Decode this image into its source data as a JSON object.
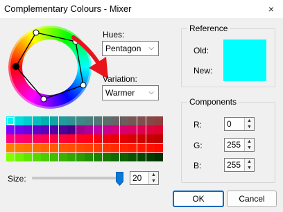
{
  "window": {
    "title": "Complementary Colours - Mixer",
    "close_icon": "×"
  },
  "hues": {
    "label": "Hues:",
    "value": "Pentagon"
  },
  "variation": {
    "label": "Variation:",
    "value": "Warmer"
  },
  "reference": {
    "title": "Reference",
    "old_label": "Old:",
    "new_label": "New:",
    "color": "#00ffff"
  },
  "components": {
    "title": "Components",
    "r_label": "R:",
    "r_value": "0",
    "g_label": "G:",
    "g_value": "255",
    "b_label": "B:",
    "b_value": "255"
  },
  "size": {
    "label": "Size:",
    "value": "20",
    "level": 20,
    "max": 20
  },
  "buttons": {
    "ok": "OK",
    "cancel": "Cancel"
  },
  "colors": {
    "accent": "#0067c0",
    "arrow": "#e8141c",
    "slider_thumb": "#0a78d7"
  },
  "palette": [
    [
      "#00f6f6",
      "#00dede",
      "#00cece",
      "#00bebe",
      "#00afaf",
      "#11a5a5",
      "#219b9b",
      "#2f9191",
      "#3d8787",
      "#4a7e7e",
      "#547575",
      "#5d6d6d",
      "#656565",
      "#6d5d5d",
      "#765555",
      "#7f4e4e",
      "#884747",
      "#8f3f3f"
    ],
    [
      "#7f00ff",
      "#7600ee",
      "#6d00dd",
      "#6400cc",
      "#5c00bb",
      "#5500ab",
      "#4d009a",
      "#460088",
      "#a0008c",
      "#b0009a",
      "#c000a8",
      "#cc0090",
      "#d40080",
      "#d80070",
      "#dc0062",
      "#de0050",
      "#e00040",
      "#e20030"
    ],
    [
      "#ff007f",
      "#ff0074",
      "#ff0068",
      "#ff005c",
      "#ff0050",
      "#ff0044",
      "#ff0038",
      "#ff002c",
      "#ff0020",
      "#ff0014",
      "#f80010",
      "#f0000c",
      "#e80008",
      "#e00004",
      "#d80000",
      "#cf0000",
      "#c60000",
      "#bd0000"
    ],
    [
      "#ff8000",
      "#ff7a00",
      "#ff7300",
      "#ff6c00",
      "#ff6500",
      "#ff5e00",
      "#ff5700",
      "#ff5000",
      "#ff4900",
      "#ff4200",
      "#ff3b00",
      "#ff3400",
      "#ff2d00",
      "#ff2600",
      "#ff1f00",
      "#ff1800",
      "#ff1100",
      "#ff0a00"
    ],
    [
      "#7fff00",
      "#6ff200",
      "#5fe600",
      "#54d900",
      "#4acd00",
      "#41c000",
      "#38b400",
      "#30a800",
      "#289c00",
      "#228f00",
      "#1c8300",
      "#177700",
      "#126b00",
      "#0e6000",
      "#0a5400",
      "#074800",
      "#043c00",
      "#023000"
    ]
  ]
}
